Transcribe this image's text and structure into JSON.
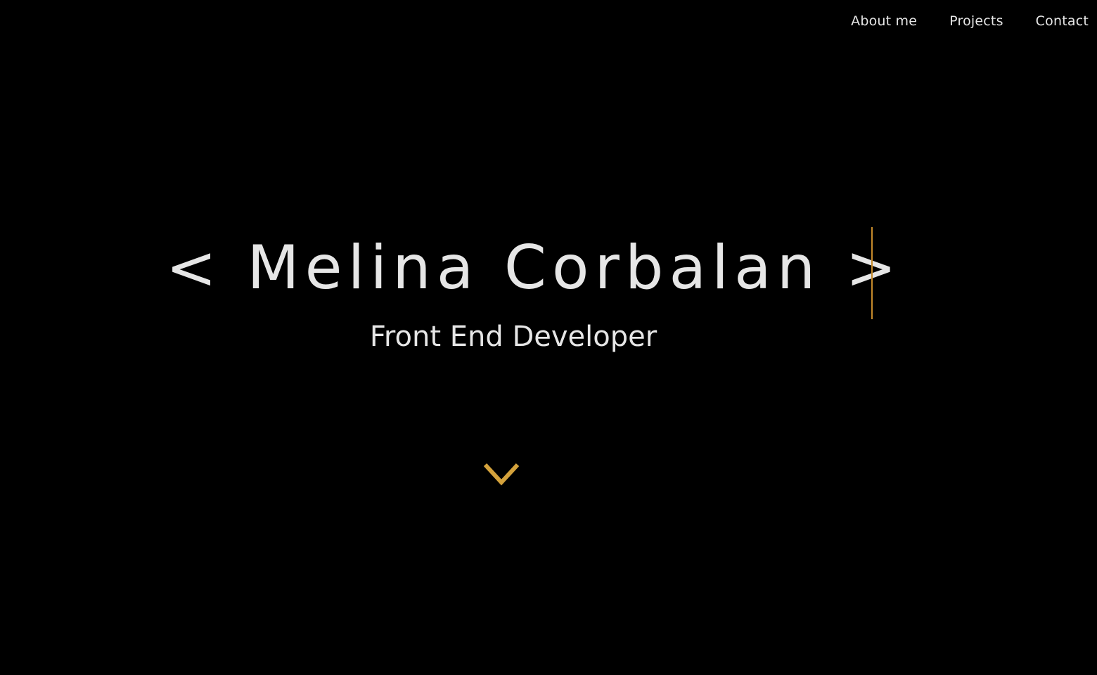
{
  "nav": {
    "items": [
      {
        "label": "About me"
      },
      {
        "label": "Projects"
      },
      {
        "label": "Contact"
      }
    ]
  },
  "hero": {
    "title": "< Melina Corbalan >",
    "subtitle": "Front End Developer"
  },
  "icons": {
    "scroll": "chevron-down-icon"
  },
  "colors": {
    "background": "#000000",
    "text": "#e6e6e6",
    "accent": "#d4a23c",
    "cursor": "#c58a2a"
  }
}
